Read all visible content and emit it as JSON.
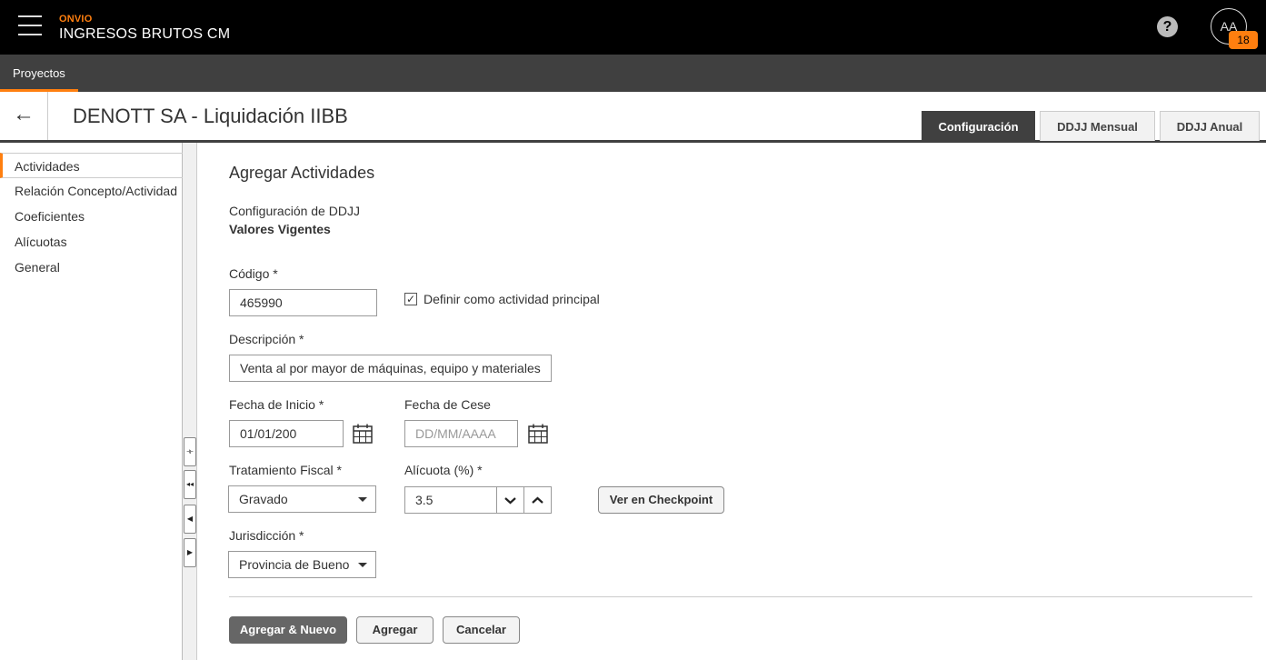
{
  "app": {
    "brand": "ONVIO",
    "title": "INGRESOS BRUTOS CM"
  },
  "user": {
    "initials": "AA",
    "notifications": "18"
  },
  "nav": {
    "tab": "Proyectos"
  },
  "header": {
    "title": "DENOTT SA - Liquidación IIBB",
    "back_icon": "arrow-left-icon",
    "tabs": [
      "Configuración",
      "DDJJ Mensual",
      "DDJJ Anual"
    ],
    "active_tab": "Configuración"
  },
  "sidebar": {
    "items": [
      "Actividades",
      "Relación Concepto/Actividad",
      "Coeficientes",
      "Alícuotas",
      "General"
    ],
    "active": "Actividades"
  },
  "form": {
    "heading": "Agregar Actividades",
    "config_label": "Configuración de DDJJ",
    "config_value": "Valores Vigentes",
    "codigo_label": "Código *",
    "codigo_value": "465990",
    "principal_label": "Definir como actividad principal",
    "principal_checked": true,
    "descripcion_label": "Descripción *",
    "descripcion_value": "Venta al por mayor de máquinas, equipo y materiales",
    "fecha_inicio_label": "Fecha de Inicio *",
    "fecha_inicio_value": "01/01/200",
    "fecha_cese_label": "Fecha de Cese",
    "fecha_cese_placeholder": "DD/MM/AAAA",
    "tratamiento_label": "Tratamiento Fiscal *",
    "tratamiento_value": "Gravado",
    "alicuota_label": "Alícuota (%) *",
    "alicuota_value": "3.5",
    "checkpoint_button": "Ver en Checkpoint",
    "jurisdiccion_label": "Jurisdicción *",
    "jurisdiccion_value": "Provincia de Bueno"
  },
  "actions": {
    "add_new": "Agregar & Nuevo",
    "add": "Agregar",
    "cancel": "Cancelar"
  },
  "colors": {
    "accent": "#ff7f0f",
    "topbar": "#000000",
    "navbar": "#404040"
  }
}
